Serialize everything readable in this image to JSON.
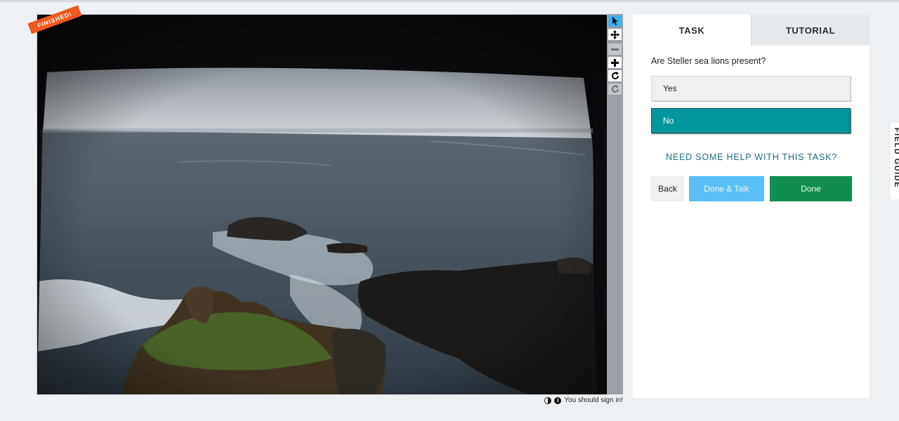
{
  "viewer": {
    "status_badge": "FINISHED!",
    "subject_alt": "Ocean view from a dark cave opening with rocky outcrops and green grass",
    "signin_text": "You should sign in!"
  },
  "toolbar": {
    "tools": [
      {
        "icon": "pointer-icon",
        "state": "active"
      },
      {
        "icon": "move-icon",
        "state": "normal"
      },
      {
        "icon": "zoom-out-icon",
        "state": "disabled"
      },
      {
        "icon": "zoom-in-icon",
        "state": "normal"
      },
      {
        "icon": "rotate-icon",
        "state": "normal"
      },
      {
        "icon": "reset-icon",
        "state": "disabled"
      }
    ]
  },
  "panel": {
    "tabs": [
      {
        "label": "TASK",
        "active": true
      },
      {
        "label": "TUTORIAL",
        "active": false
      }
    ],
    "question": "Are Steller sea lions present?",
    "answers": [
      {
        "label": "Yes",
        "selected": false
      },
      {
        "label": "No",
        "selected": true
      }
    ],
    "help_link": "NEED SOME HELP WITH THIS TASK?",
    "buttons": {
      "back": "Back",
      "done_talk": "Done & Talk",
      "done": "Done"
    }
  },
  "field_guide_label": "FIELD GUIDE",
  "colors": {
    "badge": "#f1581f",
    "selected_answer": "#00979d",
    "done_talk": "#5bc0f7",
    "done": "#0f8e4f",
    "active_tool": "#3faef0"
  }
}
